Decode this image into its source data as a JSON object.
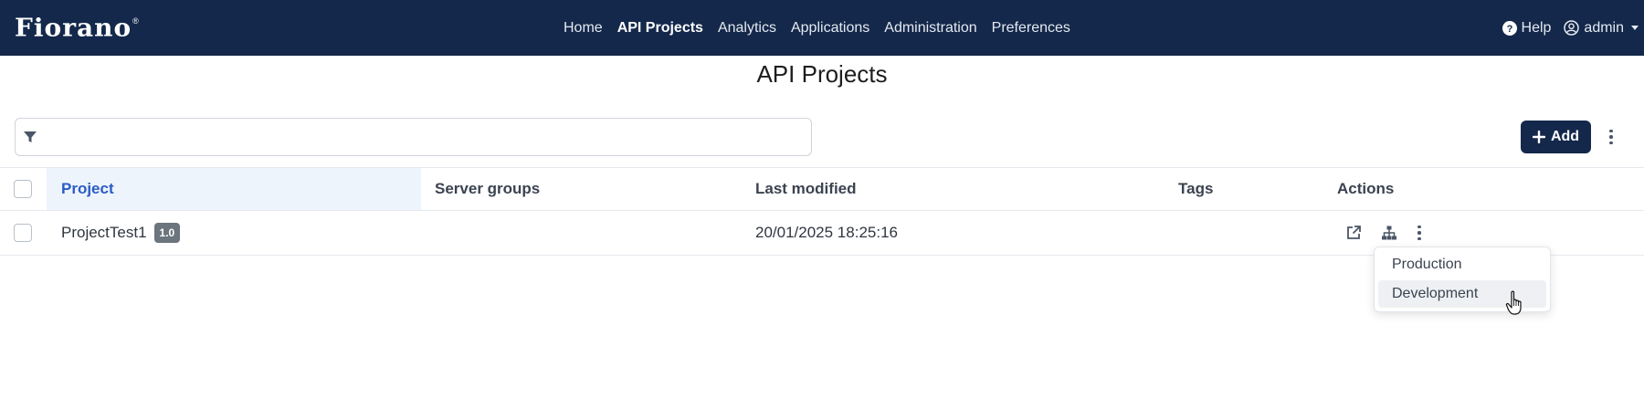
{
  "brand": {
    "name": "Fiorano",
    "tm": "®"
  },
  "nav": {
    "links": [
      {
        "label": "Home",
        "active": false
      },
      {
        "label": "API Projects",
        "active": true
      },
      {
        "label": "Analytics",
        "active": false
      },
      {
        "label": "Applications",
        "active": false
      },
      {
        "label": "Administration",
        "active": false
      },
      {
        "label": "Preferences",
        "active": false
      }
    ],
    "help_label": "Help",
    "user_label": "admin",
    "help_icon": "question-circle-icon",
    "user_icon": "user-circle-icon"
  },
  "page": {
    "title": "API Projects"
  },
  "filter": {
    "value": "",
    "placeholder": "",
    "icon": "filter-icon"
  },
  "toolbar": {
    "add_label": "Add",
    "add_icon": "plus-icon"
  },
  "table": {
    "headers": {
      "project": "Project",
      "server_groups": "Server groups",
      "last_modified": "Last modified",
      "tags": "Tags",
      "actions": "Actions"
    },
    "rows": [
      {
        "project": "ProjectTest1",
        "version": "1.0",
        "server_groups": "",
        "last_modified": "20/01/2025 18:25:16",
        "tags": ""
      }
    ]
  },
  "dropdown": {
    "items": [
      {
        "label": "Production",
        "hover": false
      },
      {
        "label": "Development",
        "hover": true
      }
    ]
  },
  "colors": {
    "navbar": "#14284b",
    "accent": "#2a5cc6",
    "header_highlight": "#eef4fc",
    "badge": "#6c757d"
  }
}
